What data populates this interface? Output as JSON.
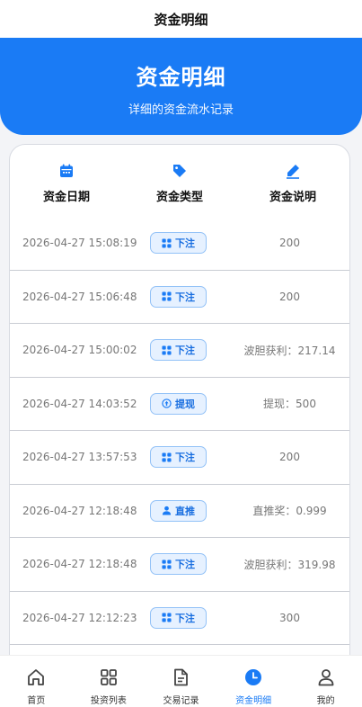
{
  "header": {
    "title": "资金明细"
  },
  "hero": {
    "title": "资金明细",
    "subtitle": "详细的资金流水记录"
  },
  "table": {
    "columns": [
      {
        "label": "资金日期",
        "icon": "calendar-icon"
      },
      {
        "label": "资金类型",
        "icon": "tag-icon"
      },
      {
        "label": "资金说明",
        "icon": "pen-icon"
      }
    ],
    "rows": [
      {
        "date": "2026-04-27 15:08:19",
        "type": "下注",
        "type_icon": "grid-icon",
        "desc": "200"
      },
      {
        "date": "2026-04-27 15:06:48",
        "type": "下注",
        "type_icon": "grid-icon",
        "desc": "200"
      },
      {
        "date": "2026-04-27 15:00:02",
        "type": "下注",
        "type_icon": "grid-icon",
        "desc": "波胆获利：217.14"
      },
      {
        "date": "2026-04-27 14:03:52",
        "type": "提现",
        "type_icon": "arrow-up-circle-icon",
        "desc": "提现：500"
      },
      {
        "date": "2026-04-27 13:57:53",
        "type": "下注",
        "type_icon": "grid-icon",
        "desc": "200"
      },
      {
        "date": "2026-04-27 12:18:48",
        "type": "直推",
        "type_icon": "user-icon",
        "desc": "直推奖：0.999"
      },
      {
        "date": "2026-04-27 12:18:48",
        "type": "下注",
        "type_icon": "grid-icon",
        "desc": "波胆获利：319.98"
      },
      {
        "date": "2026-04-27 12:12:23",
        "type": "下注",
        "type_icon": "grid-icon",
        "desc": "300"
      }
    ]
  },
  "tabbar": {
    "items": [
      {
        "label": "首页",
        "icon": "home-icon",
        "active": false
      },
      {
        "label": "投资列表",
        "icon": "grid-icon",
        "active": false
      },
      {
        "label": "交易记录",
        "icon": "document-icon",
        "active": false
      },
      {
        "label": "资金明细",
        "icon": "clock-icon",
        "active": true
      },
      {
        "label": "我的",
        "icon": "user-icon",
        "active": false
      }
    ]
  },
  "colors": {
    "primary": "#1a7bf5",
    "badge_bg": "#e6f1ff",
    "badge_border": "#93c2f7",
    "muted_text": "#777777"
  }
}
